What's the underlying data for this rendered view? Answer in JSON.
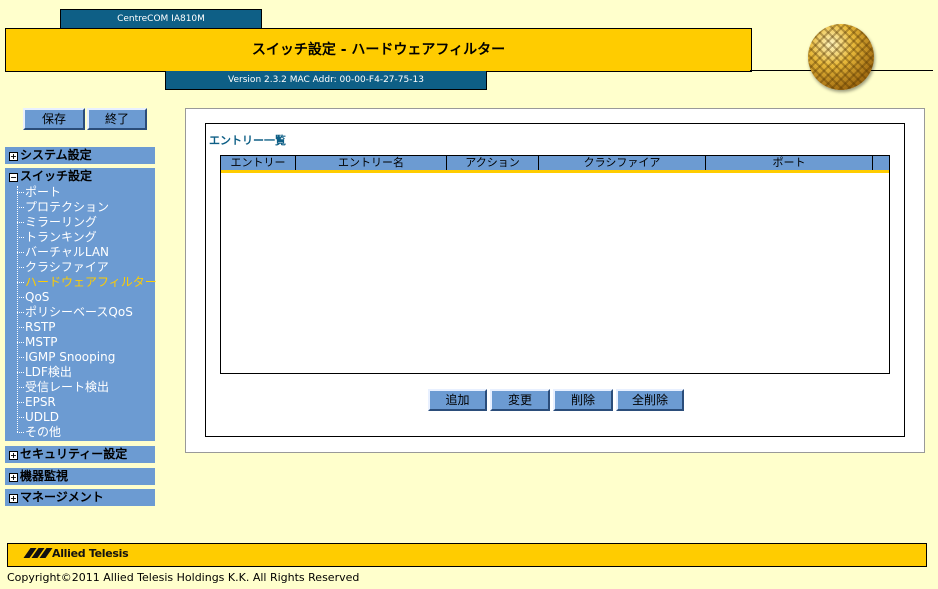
{
  "header": {
    "model": "CentreCOM IA810M",
    "title": "スイッチ設定 - ハードウェアフィルター",
    "version": "Version 2.3.2  MAC Addr: 00-00-F4-27-75-13"
  },
  "toolbar": {
    "save_label": "保存",
    "exit_label": "終了"
  },
  "sidebar": {
    "system": "システム設定",
    "switch": "スイッチ設定",
    "switch_items": [
      "ポート",
      "プロテクション",
      "ミラーリング",
      "トランキング",
      "バーチャルLAN",
      "クラシファイア",
      "ハードウェアフィルター",
      "QoS",
      "ポリシーベースQoS",
      "RSTP",
      "MSTP",
      "IGMP Snooping",
      "LDF検出",
      "受信レート検出",
      "EPSR",
      "UDLD",
      "その他"
    ],
    "security": "セキュリティー設定",
    "monitor": "機器監視",
    "management": "マネージメント",
    "expand_glyph": "+",
    "collapse_glyph": "−"
  },
  "content": {
    "list_title": "エントリー一覧",
    "columns": [
      "エントリー",
      "エントリー名",
      "アクション",
      "クラシファイア",
      "ポート"
    ],
    "rows": [],
    "buttons": {
      "add": "追加",
      "edit": "変更",
      "delete": "削除",
      "delete_all": "全削除"
    }
  },
  "footer": {
    "logo_text": "Allied Telesis",
    "copyright": "Copyright©2011 Allied Telesis Holdings K.K. All Rights Reserved"
  },
  "colors": {
    "accent_yellow": "#ffcc00",
    "menu_blue": "#6c9bd2",
    "header_blue": "#0e5f86",
    "background": "#ffffcc",
    "active_item": "#ffcc00"
  }
}
